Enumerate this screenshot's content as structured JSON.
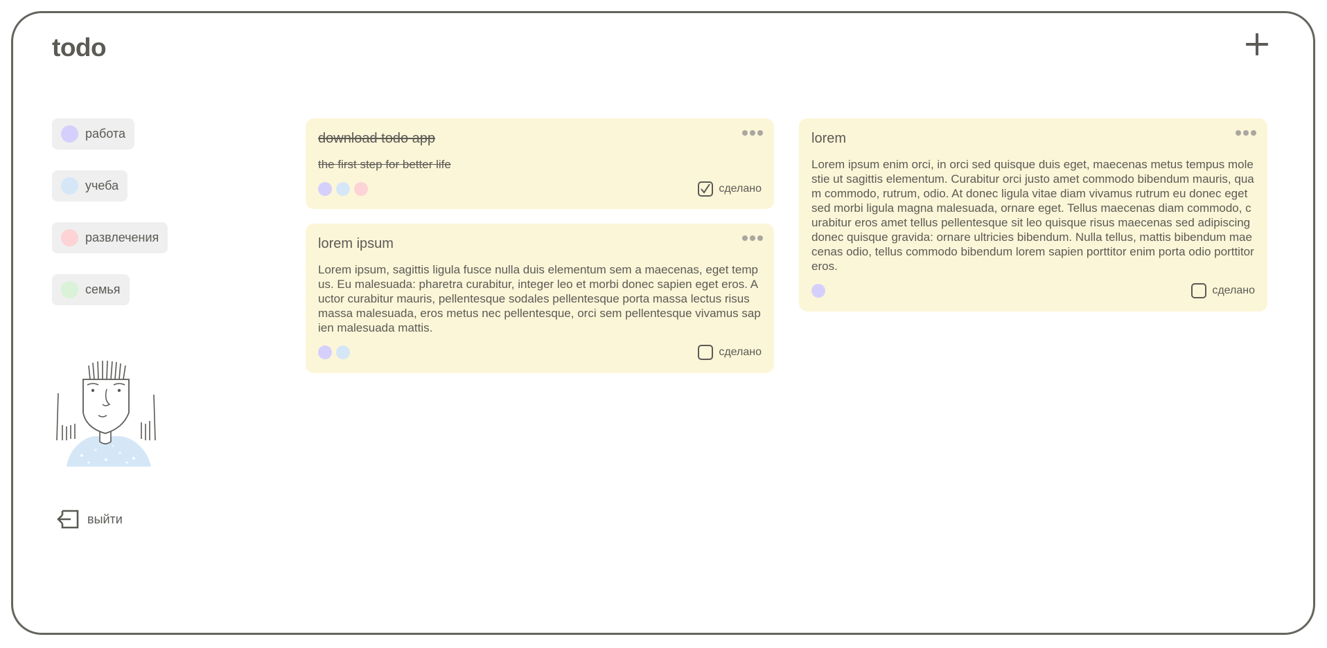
{
  "app": {
    "title": "todo",
    "add_icon": "plus-icon"
  },
  "colors": {
    "work": "#d5d0fb",
    "study": "#d5e7f7",
    "fun": "#fdd3d6",
    "family": "#d9f2d8",
    "card_bg": "#fcf6d8",
    "chip_bg": "#efefef",
    "text": "#5b5a55"
  },
  "sidebar": {
    "categories": [
      {
        "label": "работа",
        "color": "#d5d0fb"
      },
      {
        "label": "учеба",
        "color": "#d5e7f7"
      },
      {
        "label": "развлечения",
        "color": "#fdd3d6"
      },
      {
        "label": "семья",
        "color": "#d9f2d8"
      }
    ],
    "avatar_icon": "person-illustration",
    "logout": {
      "label": "выйти",
      "icon": "logout-icon"
    }
  },
  "cards": [
    {
      "title": "download todo app",
      "description": "the first step for better life",
      "tags": [
        "#d5d0fb",
        "#d5e7f7",
        "#fdd3d6"
      ],
      "done": true,
      "status_label": "сделано"
    },
    {
      "title": "lorem ipsum",
      "description": "Lorem ipsum, sagittis ligula fusce nulla duis elementum sem a maecenas, eget tempus. Eu malesuada: pharetra curabitur, integer leo et morbi donec sapien eget eros. Auctor curabitur mauris, pellentesque sodales pellentesque porta massa lectus risus massa malesuada, eros metus nec pellentesque, orci sem pellentesque vivamus sapien malesuada mattis.",
      "tags": [
        "#d5d0fb",
        "#d5e7f7"
      ],
      "done": false,
      "status_label": "сделано"
    },
    {
      "title": "lorem",
      "description": "Lorem ipsum enim orci, in orci sed quisque duis eget, maecenas metus tempus molestie ut sagittis elementum. Curabitur orci justo amet commodo bibendum mauris, quam commodo, rutrum, odio. At donec ligula vitae diam vivamus rutrum eu donec eget sed morbi ligula magna malesuada, ornare eget. Tellus maecenas diam commodo, curabitur eros amet tellus pellentesque sit leo quisque risus maecenas sed adipiscing donec quisque gravida: ornare ultricies bibendum. Nulla tellus, mattis bibendum maecenas odio, tellus commodo bibendum lorem sapien porttitor enim porta odio porttitor eros.",
      "tags": [
        "#d5d0fb"
      ],
      "done": false,
      "status_label": "сделано"
    }
  ]
}
